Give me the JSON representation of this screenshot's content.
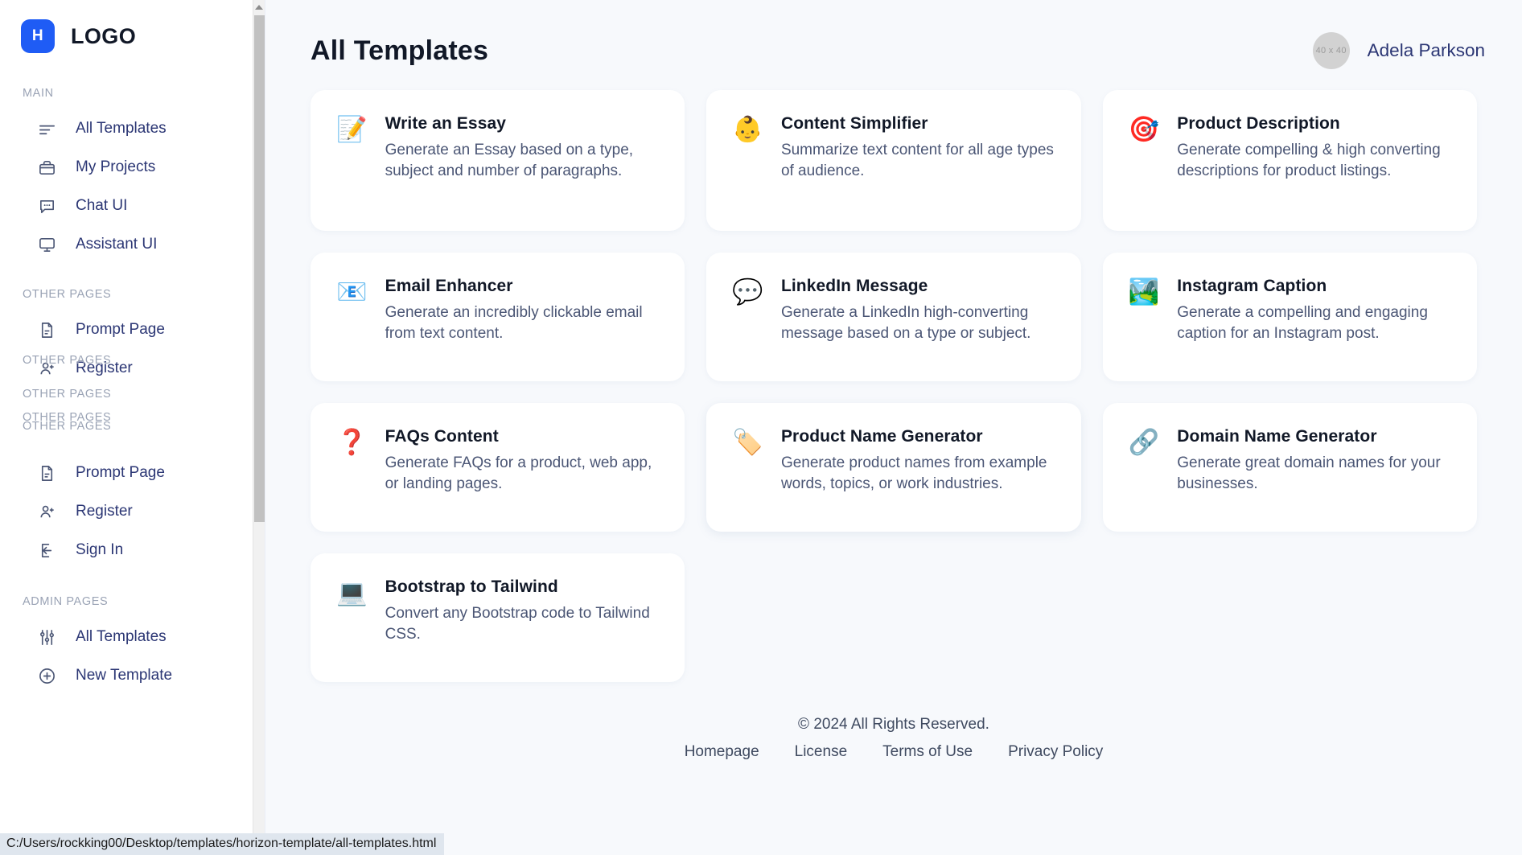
{
  "brand": {
    "mark": "H",
    "name": "LOGO"
  },
  "sidebar": {
    "sections": [
      {
        "label": "MAIN",
        "items": [
          {
            "label": "All Templates",
            "icon": "list-icon"
          },
          {
            "label": "My Projects",
            "icon": "briefcase-icon"
          },
          {
            "label": "Chat UI",
            "icon": "chat-bubble-icon"
          },
          {
            "label": "Assistant UI",
            "icon": "monitor-icon"
          }
        ]
      },
      {
        "label": "OTHER PAGES",
        "items": [
          {
            "label": "Prompt Page",
            "icon": "document-icon"
          },
          {
            "label": "Register",
            "icon": "user-plus-icon"
          }
        ]
      },
      {
        "label": "OTHER PAGES",
        "items": [
          {
            "label": "Prompt Page",
            "icon": "document-icon"
          },
          {
            "label": "Register",
            "icon": "user-plus-icon"
          },
          {
            "label": "Sign In",
            "icon": "sign-in-icon"
          }
        ]
      },
      {
        "label": "ADMIN PAGES",
        "items": [
          {
            "label": "All Templates",
            "icon": "sliders-icon"
          },
          {
            "label": "New Template",
            "icon": "plus-circle-icon"
          }
        ]
      }
    ],
    "overlap_labels": [
      "OTHER PAGES",
      "OTHER PAGES",
      "OTHER PAGES",
      "OTHER PAGES"
    ]
  },
  "header": {
    "title": "All Templates",
    "user": {
      "name": "Adela Parkson",
      "avatar_placeholder": "40 x 40"
    }
  },
  "templates": [
    {
      "icon": "memo-icon",
      "glyph": "📝",
      "title": "Write an Essay",
      "description": "Generate an Essay based on a type, subject and number of paragraphs."
    },
    {
      "icon": "baby-icon",
      "glyph": "👶",
      "title": "Content Simplifier",
      "description": "Summarize text content for all age types of audience."
    },
    {
      "icon": "dart-target-icon",
      "glyph": "🎯",
      "title": "Product Description",
      "description": "Generate compelling & high converting descriptions for product listings."
    },
    {
      "icon": "envelope-at-icon",
      "glyph": "📧",
      "title": "Email Enhancer",
      "description": "Generate an incredibly clickable email from text content."
    },
    {
      "icon": "speech-balloon-icon",
      "glyph": "💬",
      "title": "LinkedIn Message",
      "description": "Generate a LinkedIn high-converting message based on a type or subject."
    },
    {
      "icon": "national-park-icon",
      "glyph": "🏞️",
      "title": "Instagram Caption",
      "description": "Generate a compelling and engaging caption for an Instagram post."
    },
    {
      "icon": "question-mark-icon",
      "glyph": "❓",
      "title": "FAQs Content",
      "description": "Generate FAQs for a product, web app, or landing pages."
    },
    {
      "icon": "label-tag-icon",
      "glyph": "🏷️",
      "title": "Product Name Generator",
      "description": "Generate product names from example words, topics, or work industries."
    },
    {
      "icon": "link-chain-icon",
      "glyph": "🔗",
      "title": "Domain Name Generator",
      "description": "Generate great domain names for your businesses."
    },
    {
      "icon": "laptop-icon",
      "glyph": "💻",
      "title": "Bootstrap to Tailwind",
      "description": "Convert any Bootstrap code to Tailwind CSS."
    }
  ],
  "footer": {
    "copyright": "© 2024 All Rights Reserved.",
    "links": [
      "Homepage",
      "License",
      "Terms of Use",
      "Privacy Policy"
    ]
  },
  "statusbar": {
    "url": "C:/Users/rockking00/Desktop/templates/horizon-template/all-templates.html"
  },
  "colors": {
    "brand": "#1f5cf5",
    "title": "#111827",
    "muted": "#9aa3b5",
    "nav": "#2b3674",
    "page_bg": "#f7f9fc"
  }
}
